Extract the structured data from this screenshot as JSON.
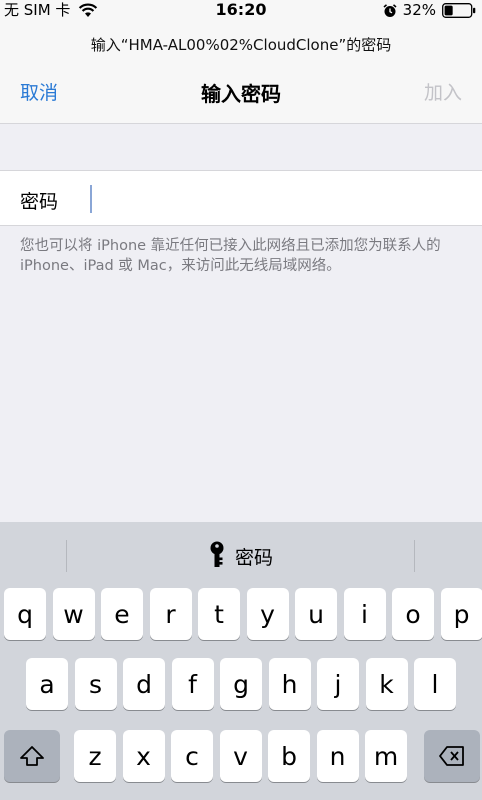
{
  "status_bar": {
    "carrier": "无 SIM 卡",
    "time": "16:20",
    "battery_percent": "32%",
    "battery_level": 0.32,
    "icons": [
      "wifi-icon",
      "alarm-icon",
      "battery-icon"
    ]
  },
  "prompt": {
    "text": "输入“HMA-AL00%02%CloudClone”的密码"
  },
  "nav": {
    "cancel_label": "取消",
    "title": "输入密码",
    "join_label": "加入"
  },
  "form": {
    "password_label": "密码",
    "password_value": ""
  },
  "hint": {
    "text": "您也可以将 iPhone 靠近任何已接入此网络且已添加您为联系人的 iPhone、iPad 或 Mac，来访问此无线局域网络。"
  },
  "keyboard": {
    "suggestion_label": "密码",
    "row1": [
      "q",
      "w",
      "e",
      "r",
      "t",
      "y",
      "u",
      "i",
      "o",
      "p"
    ],
    "row2": [
      "a",
      "s",
      "d",
      "f",
      "g",
      "h",
      "j",
      "k",
      "l"
    ],
    "row3": [
      "z",
      "x",
      "c",
      "v",
      "b",
      "n",
      "m"
    ]
  },
  "colors": {
    "accent": "#2a7ad5",
    "disabled": "#c3c3c8",
    "background": "#efeff4",
    "keyboard_bg": "#d2d5db"
  }
}
